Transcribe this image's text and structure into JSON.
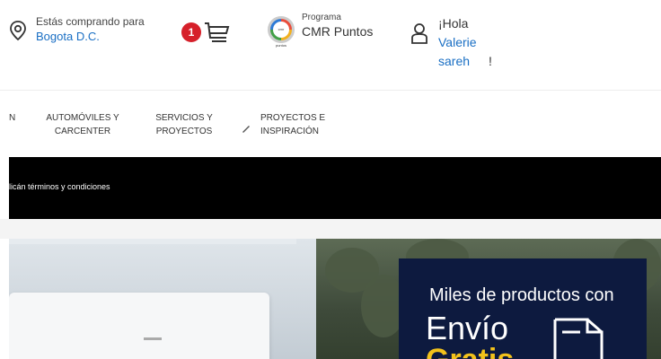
{
  "header": {
    "location": {
      "label": "Estás comprando para",
      "city": "Bogota D.C.",
      "icon": "location-pin-icon"
    },
    "cart": {
      "count": "1",
      "icon": "cart-icon",
      "badge_color": "#d6202a"
    },
    "program": {
      "label": "Programa",
      "name": "CMR Puntos",
      "logo_text": "cmr puntos"
    },
    "user": {
      "greeting": "¡Hola",
      "name": "Valerie sareh",
      "suffix": "!",
      "icon": "user-icon"
    }
  },
  "nav": {
    "items": [
      {
        "label": "N"
      },
      {
        "label": "AUTOMÓVILES Y CARCENTER"
      },
      {
        "label": "SERVICIOS Y PROYECTOS"
      },
      {
        "label": "PROYECTOS E INSPIRACIÓN",
        "icon": "pencil-icon"
      }
    ]
  },
  "promo_bar": {
    "text": "licán términos y condiciones"
  },
  "hero": {
    "card_line1": "Miles de productos con",
    "card_line2": "Envío",
    "card_line3": "Gratis",
    "card_icon": "box-icon",
    "colors": {
      "card_bg": "#0d1a3f",
      "accent": "#f3c21b"
    }
  }
}
